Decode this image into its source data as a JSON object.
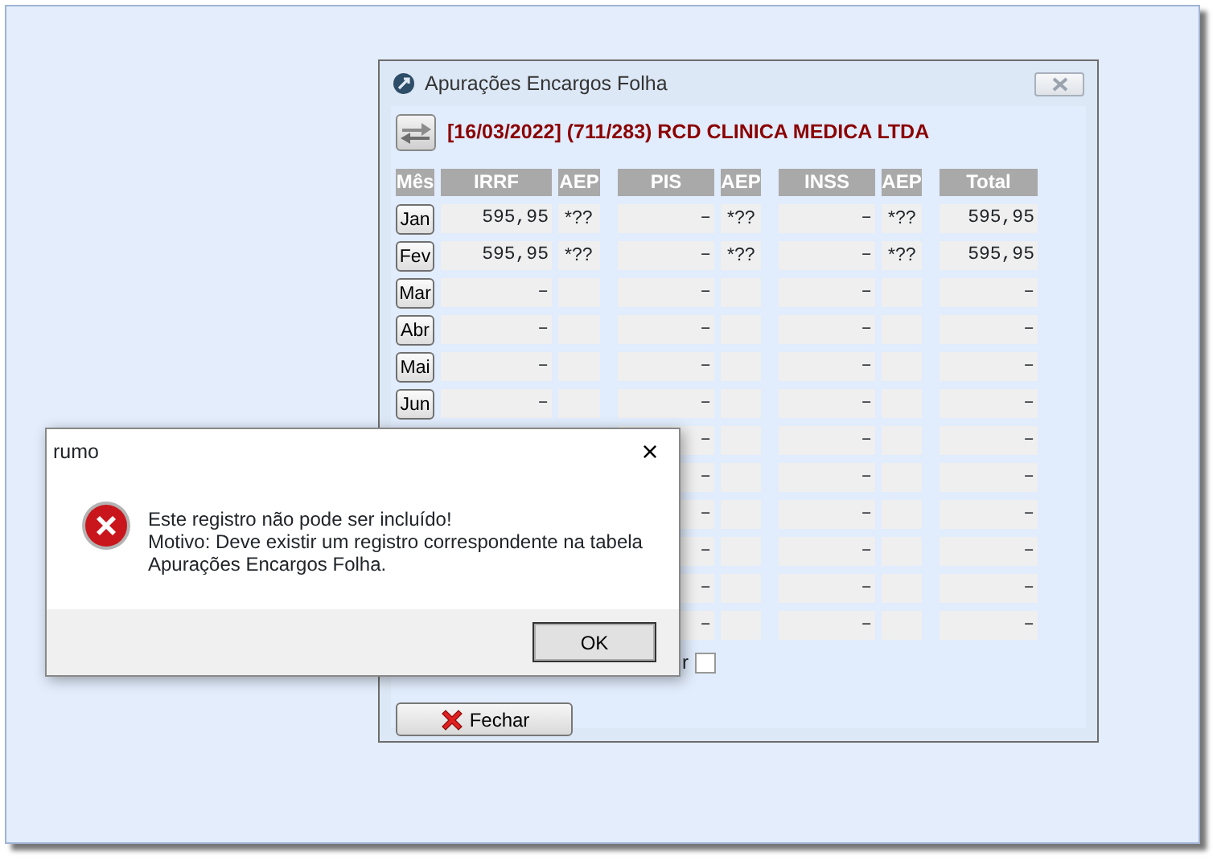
{
  "window": {
    "title": "Apurações Encargos Folha"
  },
  "company_header": "[16/03/2022] (711/283) RCD CLINICA MEDICA LTDA",
  "columns": [
    "Mês",
    "IRRF",
    "AEP",
    "PIS",
    "AEP",
    "INSS",
    "AEP",
    "Total"
  ],
  "rows": [
    {
      "month": "Jan",
      "cells": [
        "595,95",
        "*??",
        "–",
        "*??",
        "–",
        "*??",
        "595,95"
      ]
    },
    {
      "month": "Fev",
      "cells": [
        "595,95",
        "*??",
        "–",
        "*??",
        "–",
        "*??",
        "595,95"
      ]
    },
    {
      "month": "Mar",
      "cells": [
        "–",
        null,
        "–",
        null,
        "–",
        null,
        "–"
      ]
    },
    {
      "month": "Abr",
      "cells": [
        "–",
        null,
        "–",
        null,
        "–",
        null,
        "–"
      ]
    },
    {
      "month": "Mai",
      "cells": [
        "–",
        null,
        "–",
        null,
        "–",
        null,
        "–"
      ]
    },
    {
      "month": "Jun",
      "cells": [
        "–",
        null,
        "–",
        null,
        "–",
        null,
        "–"
      ]
    },
    {
      "cells": [
        "–",
        null,
        "–",
        null,
        "–"
      ]
    },
    {
      "cells": [
        "–",
        null,
        "–",
        null,
        "–"
      ]
    },
    {
      "cells": [
        "–",
        null,
        "–",
        null,
        "–"
      ]
    },
    {
      "cells": [
        "–",
        null,
        "–",
        null,
        "–"
      ]
    },
    {
      "cells": [
        "–",
        null,
        "–",
        null,
        "–"
      ]
    },
    {
      "cells": [
        "–",
        null,
        "–",
        null,
        "–"
      ]
    }
  ],
  "option": {
    "label": "r",
    "checked": false
  },
  "close_button": "Fechar",
  "dialog": {
    "title": "rumo",
    "close": "×",
    "message": "Este registro não pode ser incluído!\nMotivo: Deve existir um registro correspondente na tabela\nApurações Encargos Folha.",
    "ok": "OK"
  }
}
